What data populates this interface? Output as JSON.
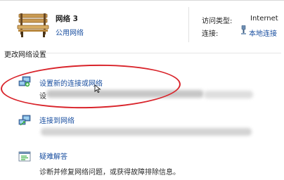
{
  "network": {
    "name": "网络 3",
    "type": "公用网络"
  },
  "details": {
    "access_type_label": "访问类型:",
    "access_type_value": "Internet",
    "connection_label": "连接:",
    "connection_value": "本地连接"
  },
  "section": {
    "title": "更改网络设置"
  },
  "tasks": [
    {
      "title": "设置新的连接或网络",
      "desc_visible": "设",
      "icon": "new-connection-icon"
    },
    {
      "title": "连接到网络",
      "desc_visible": "",
      "icon": "connect-network-icon"
    },
    {
      "title": "疑难解答",
      "desc_visible": "诊断并修复网络问题，或获得故障排除信息。",
      "icon": "troubleshoot-icon"
    }
  ],
  "colors": {
    "link": "#1a4fa0",
    "highlight_ellipse": "#d9242b"
  }
}
